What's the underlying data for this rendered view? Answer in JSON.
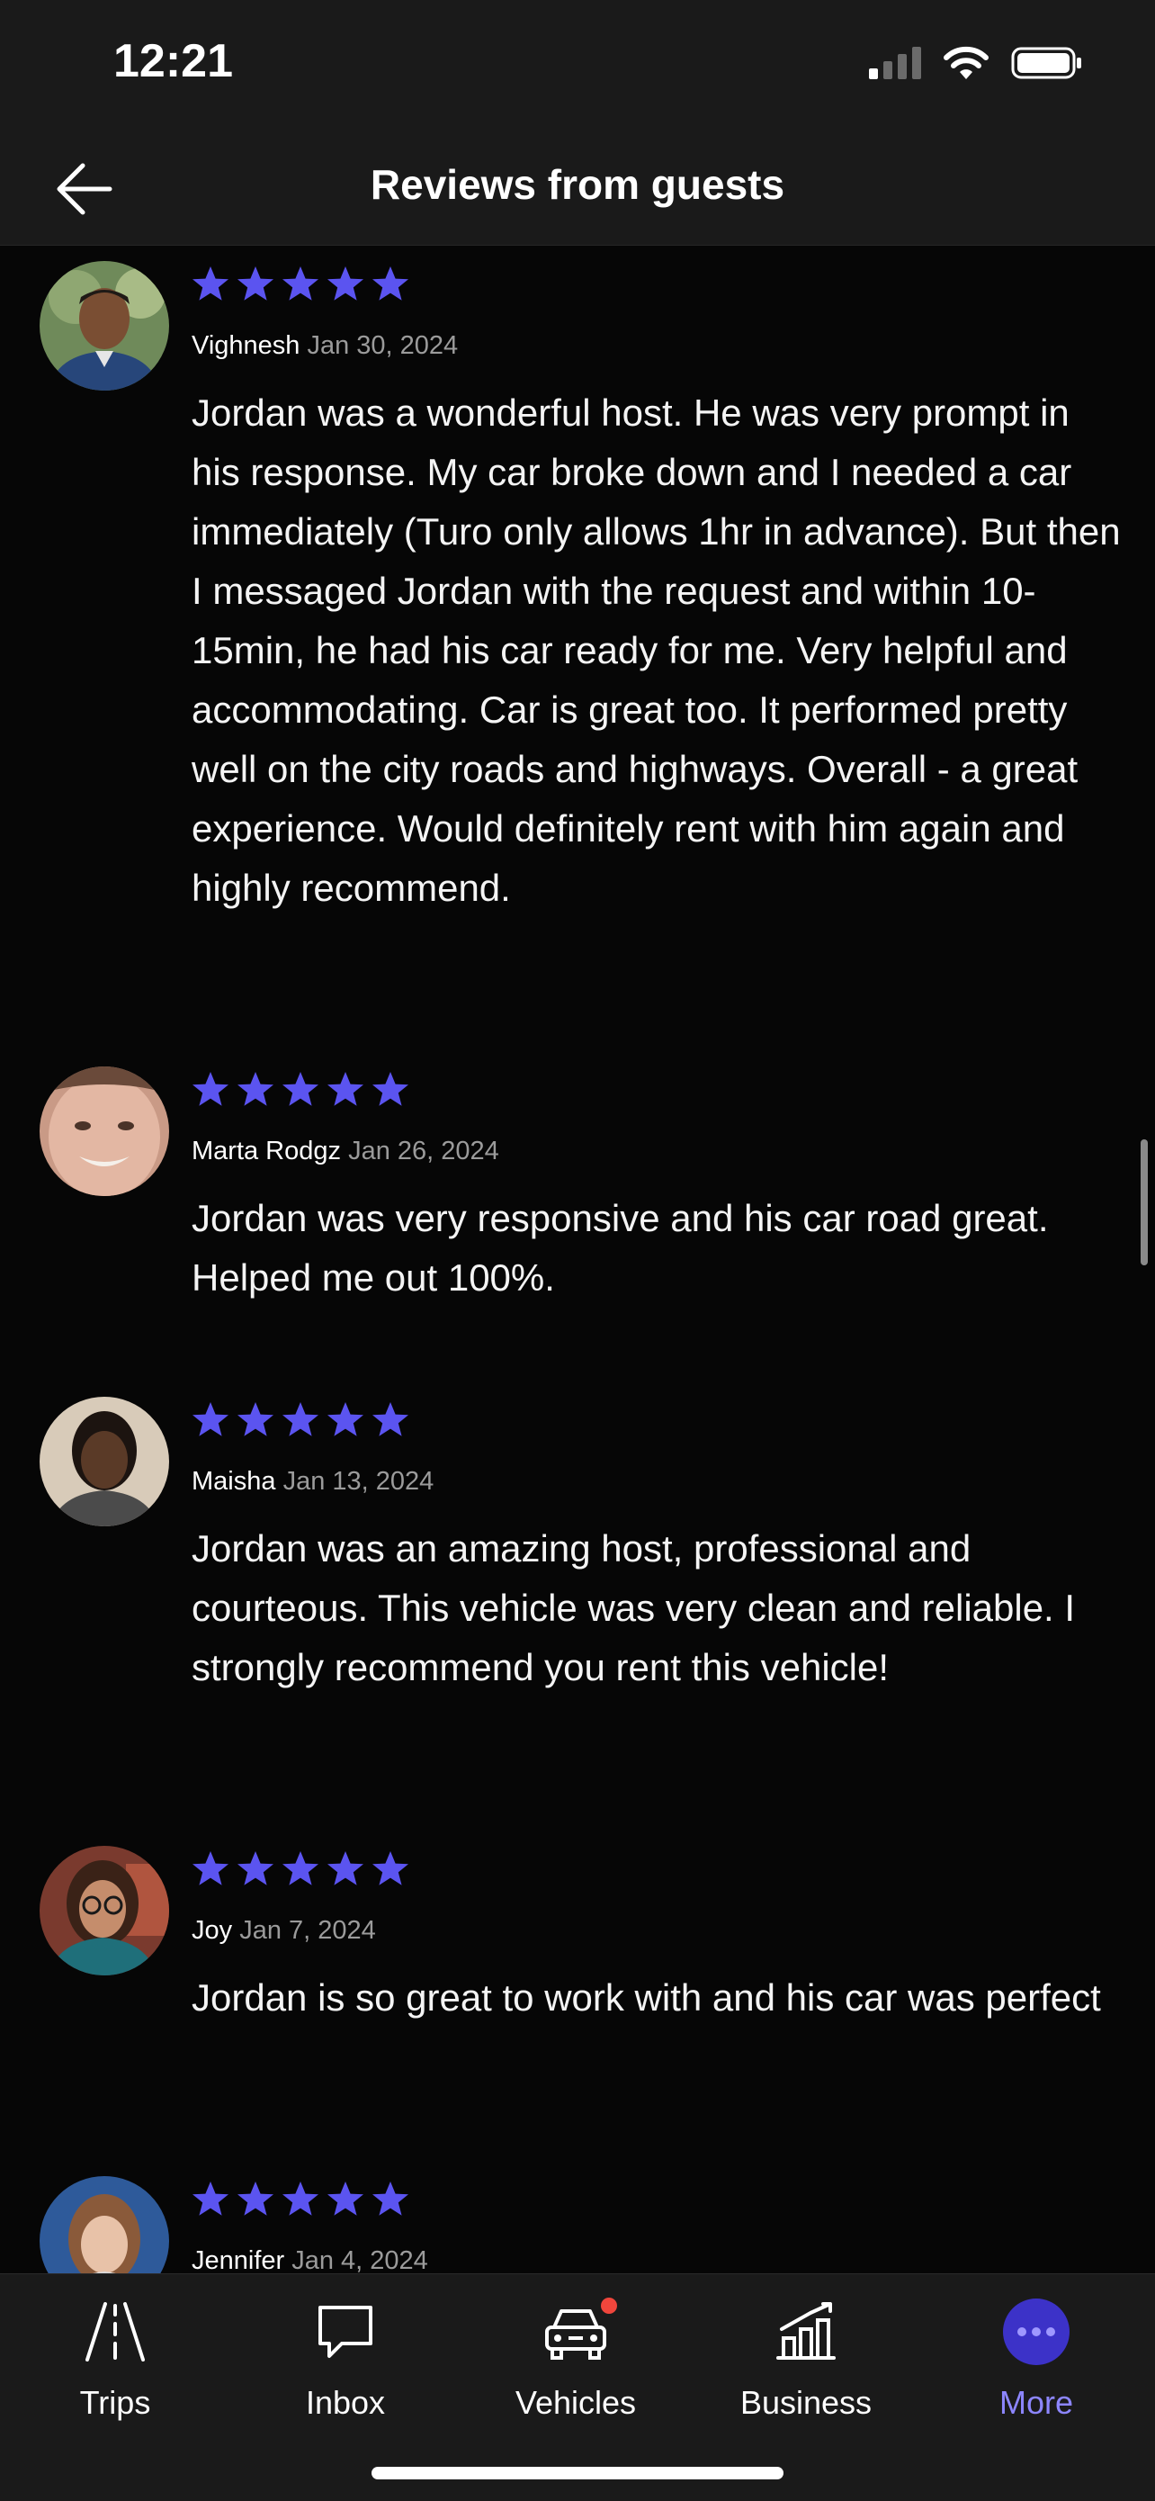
{
  "status_bar": {
    "time": "12:21"
  },
  "header": {
    "title": "Reviews from guests"
  },
  "reviews": [
    {
      "name": "Vighnesh",
      "date": "Jan 30, 2024",
      "rating": 5,
      "text": "Jordan was a wonderful host. He was very prompt in his response. My car broke down and I needed a car immediately (Turo only allows 1hr in advance). But then I messaged Jordan with the request and within 10-15min, he had his car ready for me. Very helpful and accommodating. Car is great too. It performed pretty well on the city roads and highways. Overall - a great experience. Would definitely rent with him again and highly recommend."
    },
    {
      "name": "Marta Rodgz",
      "date": "Jan 26, 2024",
      "rating": 5,
      "text": "Jordan was very responsive and his car road great. Helped me out 100%."
    },
    {
      "name": "Maisha",
      "date": "Jan 13, 2024",
      "rating": 5,
      "text": "Jordan was an amazing host, professional and courteous. This vehicle was very clean and reliable. I strongly recommend you rent this vehicle!"
    },
    {
      "name": "Joy",
      "date": "Jan 7, 2024",
      "rating": 5,
      "text": "Jordan is so great to work with and his car was perfect"
    },
    {
      "name": "Jennifer",
      "date": "Jan 4, 2024",
      "rating": 5,
      "text": ""
    }
  ],
  "tabs": [
    {
      "label": "Trips",
      "icon": "trips-icon",
      "active": false
    },
    {
      "label": "Inbox",
      "icon": "inbox-icon",
      "active": false
    },
    {
      "label": "Vehicles",
      "icon": "car-icon",
      "active": false,
      "notification": true
    },
    {
      "label": "Business",
      "icon": "business-chart-icon",
      "active": false
    },
    {
      "label": "More",
      "icon": "more-icon",
      "active": true
    }
  ],
  "colors": {
    "accent": "#5b54f0",
    "active_tab": "#8d86ff",
    "notification": "#f0463c",
    "background": "#060606",
    "bar": "#1a1a1a"
  }
}
